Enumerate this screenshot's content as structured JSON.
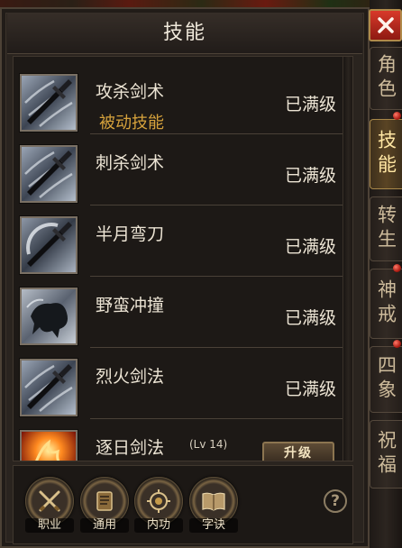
{
  "window": {
    "title": "技能"
  },
  "tabs": [
    {
      "label": "角色",
      "active": false
    },
    {
      "label": "技能",
      "active": true
    },
    {
      "label": "转生",
      "active": false
    },
    {
      "label": "神戒",
      "active": false
    },
    {
      "label": "四象",
      "active": false
    },
    {
      "label": "祝福",
      "active": false
    }
  ],
  "skills": [
    {
      "name": "攻杀剑术",
      "note": "被动技能",
      "status": "已满级",
      "icon": "sword-icon"
    },
    {
      "name": "刺杀剑术",
      "status": "已满级",
      "icon": "sword-icon"
    },
    {
      "name": "半月弯刀",
      "status": "已满级",
      "icon": "crescent-sword-icon"
    },
    {
      "name": "野蛮冲撞",
      "status": "已满级",
      "icon": "beast-charge-icon"
    },
    {
      "name": "烈火剑法",
      "status": "已满级",
      "icon": "sword-icon"
    },
    {
      "name": "逐日剑法",
      "level": "(Lv 14)",
      "action": "升级",
      "icon": "fire-icon"
    }
  ],
  "bottom": {
    "buttons": [
      {
        "label": "职业",
        "icon": "crossed-swords-icon"
      },
      {
        "label": "通用",
        "icon": "scroll-icon"
      },
      {
        "label": "内功",
        "icon": "aura-icon"
      },
      {
        "label": "字诀",
        "icon": "open-book-icon"
      }
    ],
    "help": "?"
  },
  "colors": {
    "accent": "#d6a23c",
    "text": "#ece4d4",
    "active_tab": "#ffe6a3",
    "close": "#c0281e"
  }
}
